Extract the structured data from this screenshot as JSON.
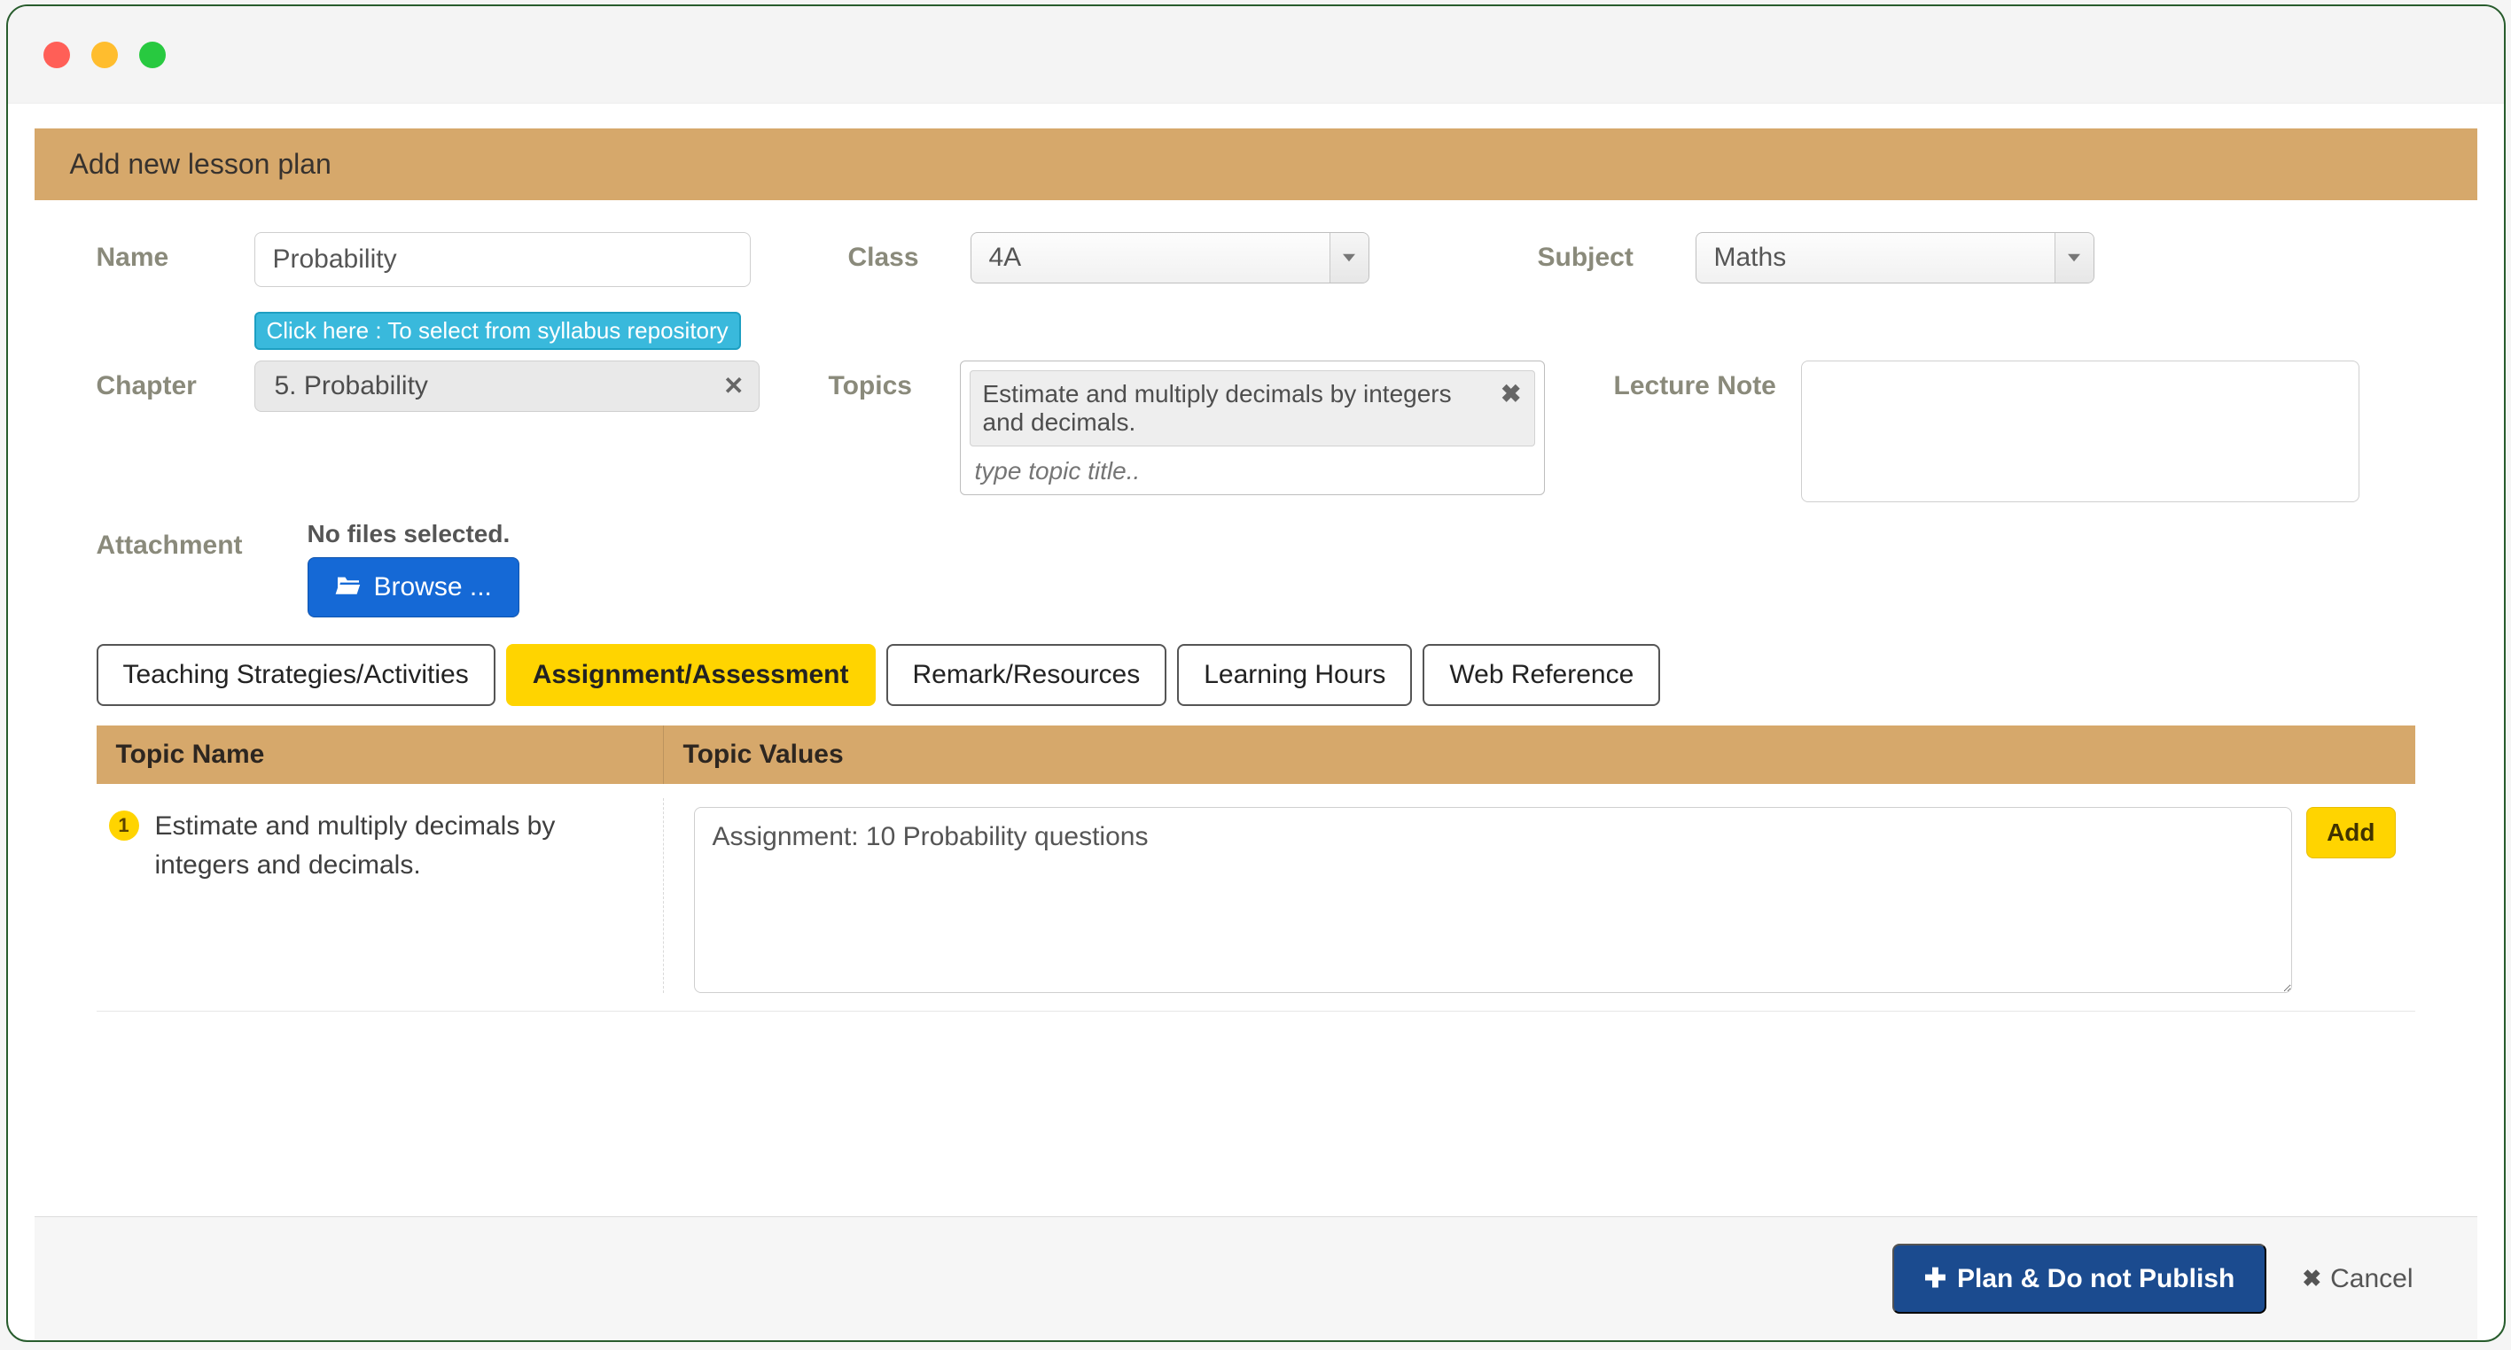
{
  "window": {
    "dots": [
      "red",
      "yellow",
      "green"
    ]
  },
  "header": {
    "title": "Add new lesson plan"
  },
  "form": {
    "name": {
      "label": "Name",
      "value": "Probability"
    },
    "class": {
      "label": "Class",
      "selected": "4A"
    },
    "subject": {
      "label": "Subject",
      "selected": "Maths"
    },
    "syllabus_hint": "Click here : To select from syllabus repository",
    "chapter": {
      "label": "Chapter",
      "selected": "5. Probability"
    },
    "topics": {
      "label": "Topics",
      "chips": [
        "Estimate and multiply decimals by integers and decimals."
      ],
      "placeholder": "type topic title.."
    },
    "lecture_note": {
      "label": "Lecture Note",
      "value": ""
    },
    "attachment": {
      "label": "Attachment",
      "status": "No files selected.",
      "browse_label": "Browse ..."
    }
  },
  "tabs": [
    {
      "label": "Teaching Strategies/Activities",
      "active": false
    },
    {
      "label": "Assignment/Assessment",
      "active": true
    },
    {
      "label": "Remark/Resources",
      "active": false
    },
    {
      "label": "Learning Hours",
      "active": false
    },
    {
      "label": "Web Reference",
      "active": false
    }
  ],
  "table": {
    "columns": {
      "name": "Topic Name",
      "values": "Topic Values"
    },
    "rows": [
      {
        "index": "1",
        "topic": "Estimate and multiply decimals by integers and decimals.",
        "value": "Assignment: 10 Probability questions",
        "add_label": "Add"
      }
    ]
  },
  "footer": {
    "primary": "Plan & Do not Publish",
    "cancel": "Cancel"
  }
}
